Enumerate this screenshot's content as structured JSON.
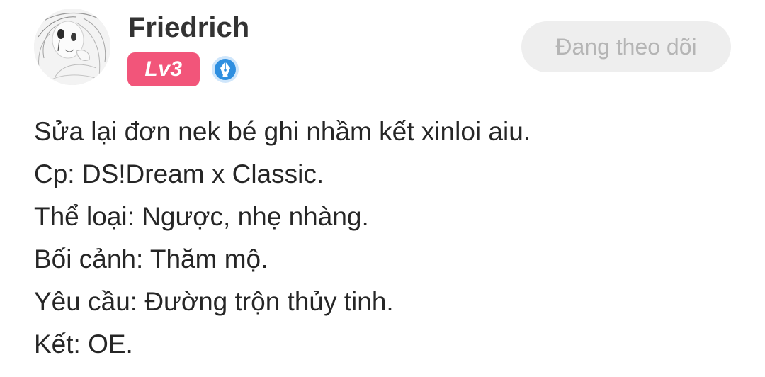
{
  "post": {
    "author": {
      "name": "Friedrich",
      "avatar_icon": "sketch-girl-avatar",
      "level": "Lv3",
      "badge_icon": "pen-nib-icon",
      "level_color": "#f2557a",
      "badge_color": "#2f8fe0"
    },
    "follow_button": {
      "label": "Đang theo dõi"
    },
    "lines": [
      "Sửa lại đơn nek bé ghi nhầm kết xinloi aiu.",
      "Cp: DS!Dream x Classic.",
      "Thể loại: Ngược, nhẹ nhàng.",
      "Bối cảnh: Thăm mộ.",
      "Yêu cầu: Đường trộn thủy tinh.",
      "Kết: OE."
    ]
  }
}
